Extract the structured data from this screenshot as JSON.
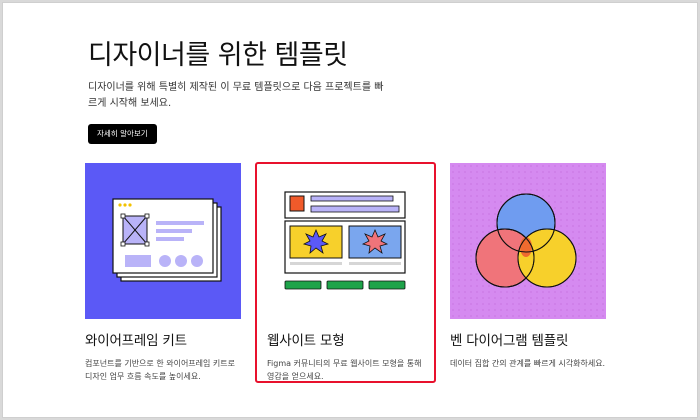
{
  "hero": {
    "title": "디자이너를 위한 템플릿",
    "subtitle": "디자이너를 위해 특별히 제작된 이 무료 템플릿으로 다음 프로젝트를 빠르게 시작해 보세요.",
    "cta_label": "자세히 알아보기"
  },
  "cards": [
    {
      "title": "와이어프레임 키트",
      "description": "컴포넌트를 기반으로 한 와이어프레임 키트로 디자인 업무 흐름 속도를 높이세요.",
      "thumbnail_icon": "wireframe-illustration",
      "bg_color": "#5b59f6"
    },
    {
      "title": "웹사이트 모형",
      "description": "Figma 커뮤니티의 무료 웹사이트 모형을 통해 영감을 얻으세요.",
      "thumbnail_icon": "website-mockup-illustration",
      "bg_color": "#ffffff",
      "highlighted": true
    },
    {
      "title": "벤 다이어그램 템플릿",
      "description": "데이터 집합 간의 관계를 빠르게 시각화하세요.",
      "thumbnail_icon": "venn-diagram-illustration",
      "bg_color": "#d58af0"
    }
  ],
  "colors": {
    "highlight": "#e8112d",
    "cta_bg": "#000000",
    "venn_blue": "#6f9cf0",
    "venn_red": "#f0747a",
    "venn_yellow": "#f7d02b"
  }
}
